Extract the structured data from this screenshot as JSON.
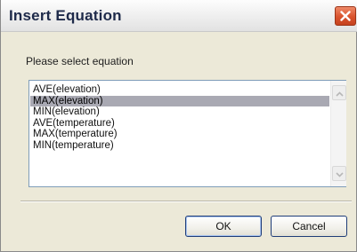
{
  "dialog": {
    "title": "Insert Equation",
    "prompt": "Please select equation"
  },
  "list": {
    "items": [
      "AVE(elevation)",
      "MAX(elevation)",
      "MIN(elevation)",
      "AVE(temperature)",
      "MAX(temperature)",
      "MIN(temperature)"
    ],
    "selected_item": "MAX(elevation)"
  },
  "buttons": {
    "ok_label": "OK",
    "cancel_label": "Cancel"
  },
  "icons": {
    "close": "close-icon",
    "scroll_up": "chevron-up-icon",
    "scroll_down": "chevron-down-icon"
  },
  "colors": {
    "close_button": "#d9532d",
    "selection": "#a9a9b3",
    "button_border": "#1f3d78"
  }
}
